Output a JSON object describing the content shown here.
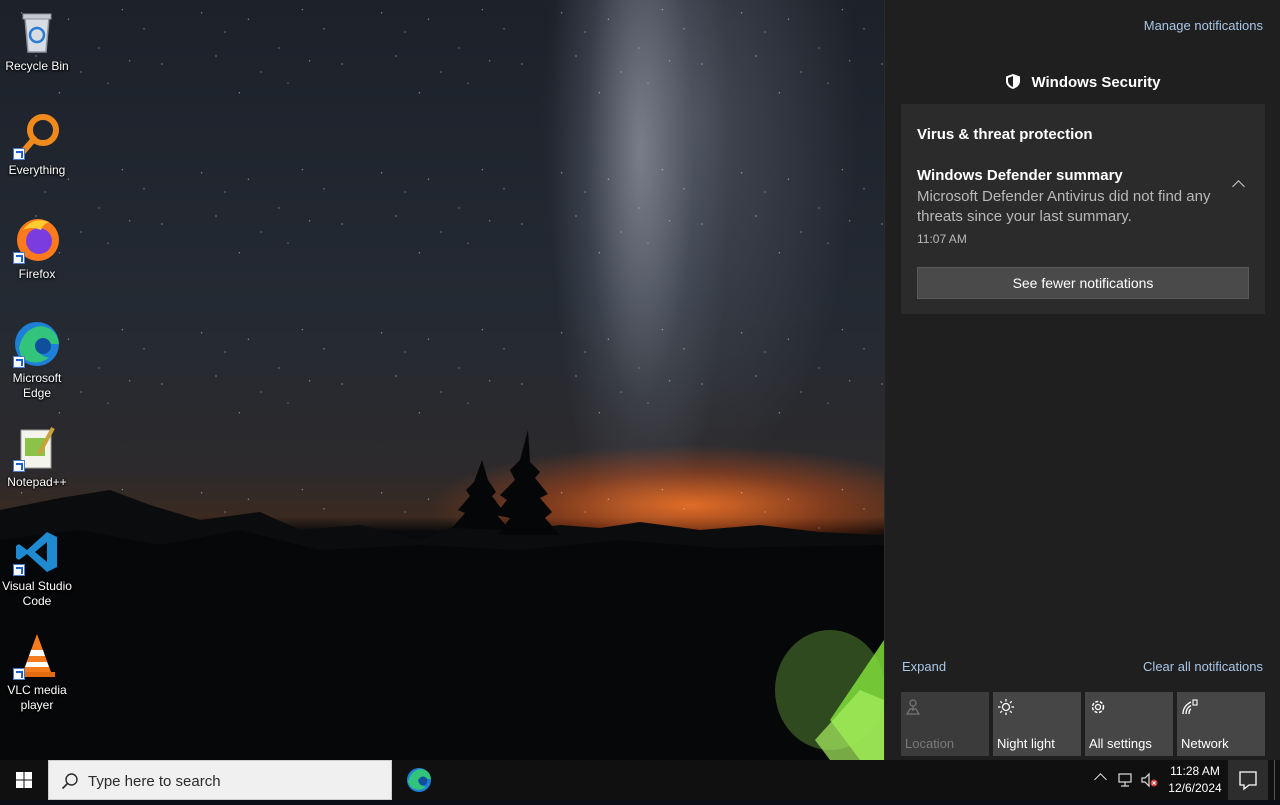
{
  "desktop": {
    "icons": [
      {
        "label": "Recycle Bin",
        "icon": "recycle-bin-icon"
      },
      {
        "label": "Everything",
        "icon": "everything-icon"
      },
      {
        "label": "Firefox",
        "icon": "firefox-icon"
      },
      {
        "label_line1": "Microsoft",
        "label_line2": "Edge",
        "icon": "edge-icon"
      },
      {
        "label": "Notepad++",
        "icon": "notepadpp-icon"
      },
      {
        "label_line1": "Visual Studio",
        "label_line2": "Code",
        "icon": "vscode-icon"
      },
      {
        "label_line1": "VLC media",
        "label_line2": "player",
        "icon": "vlc-icon"
      }
    ]
  },
  "action_center": {
    "manage_link": "Manage notifications",
    "group_title": "Windows Security",
    "notification": {
      "category": "Virus & threat protection",
      "title": "Windows Defender summary",
      "body": "Microsoft Defender Antivirus did not find any threats since your last summary.",
      "time": "11:07 AM",
      "button": "See fewer notifications"
    },
    "expand_link": "Expand",
    "clear_link": "Clear all notifications",
    "quick_actions": [
      {
        "label": "Location",
        "icon": "location-icon",
        "enabled": false
      },
      {
        "label": "Night light",
        "icon": "night-light-icon",
        "enabled": true
      },
      {
        "label": "All settings",
        "icon": "gear-icon",
        "enabled": true
      },
      {
        "label": "Network",
        "icon": "network-icon",
        "enabled": true
      }
    ]
  },
  "taskbar": {
    "search_placeholder": "Type here to search",
    "pinned": [
      {
        "icon": "edge-icon"
      }
    ],
    "clock_time": "11:28 AM",
    "clock_date": "12/6/2024"
  },
  "colors": {
    "link": "#a9c7e8",
    "panel": "#1f1f1f",
    "card": "#2b2b2b",
    "taskbar": "#101010"
  }
}
